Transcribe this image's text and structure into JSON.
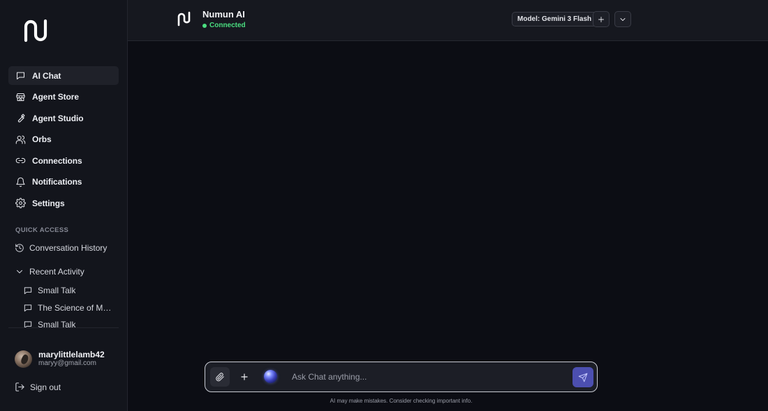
{
  "sidebar": {
    "logo_icon": "numun-logo-icon",
    "nav": [
      {
        "label": "AI Chat",
        "icon": "chat-bubble-icon",
        "active": true
      },
      {
        "label": "Agent Store",
        "icon": "store-icon"
      },
      {
        "label": "Agent Studio",
        "icon": "wrench-icon"
      },
      {
        "label": "Orbs",
        "icon": "users-icon"
      },
      {
        "label": "Connections",
        "icon": "link-icon"
      },
      {
        "label": "Notifications",
        "icon": "bell-icon"
      },
      {
        "label": "Settings",
        "icon": "gear-icon"
      }
    ],
    "quick_access": {
      "title": "QUICK ACCESS",
      "conversation_history": "Conversation History",
      "recent_activity": "Recent Activity",
      "recent_items": [
        "Small Talk",
        "The Science of Ma...",
        "Small Talk"
      ]
    },
    "user": {
      "name": "marylittlelamb42",
      "email": "maryy@gmail.com"
    },
    "sign_out": "Sign out"
  },
  "header": {
    "brand_name": "Numun AI",
    "status": "Connected",
    "model_label": "Model: Gemini 3 Flash"
  },
  "composer": {
    "placeholder": "Ask Chat anything..."
  },
  "disclaimer": "AI may make mistakes. Consider checking important info.",
  "colors": {
    "background": "#0c0d14",
    "sidebar": "#13151c",
    "status_green": "#4ade80",
    "send_button": "#4c4fb0"
  }
}
